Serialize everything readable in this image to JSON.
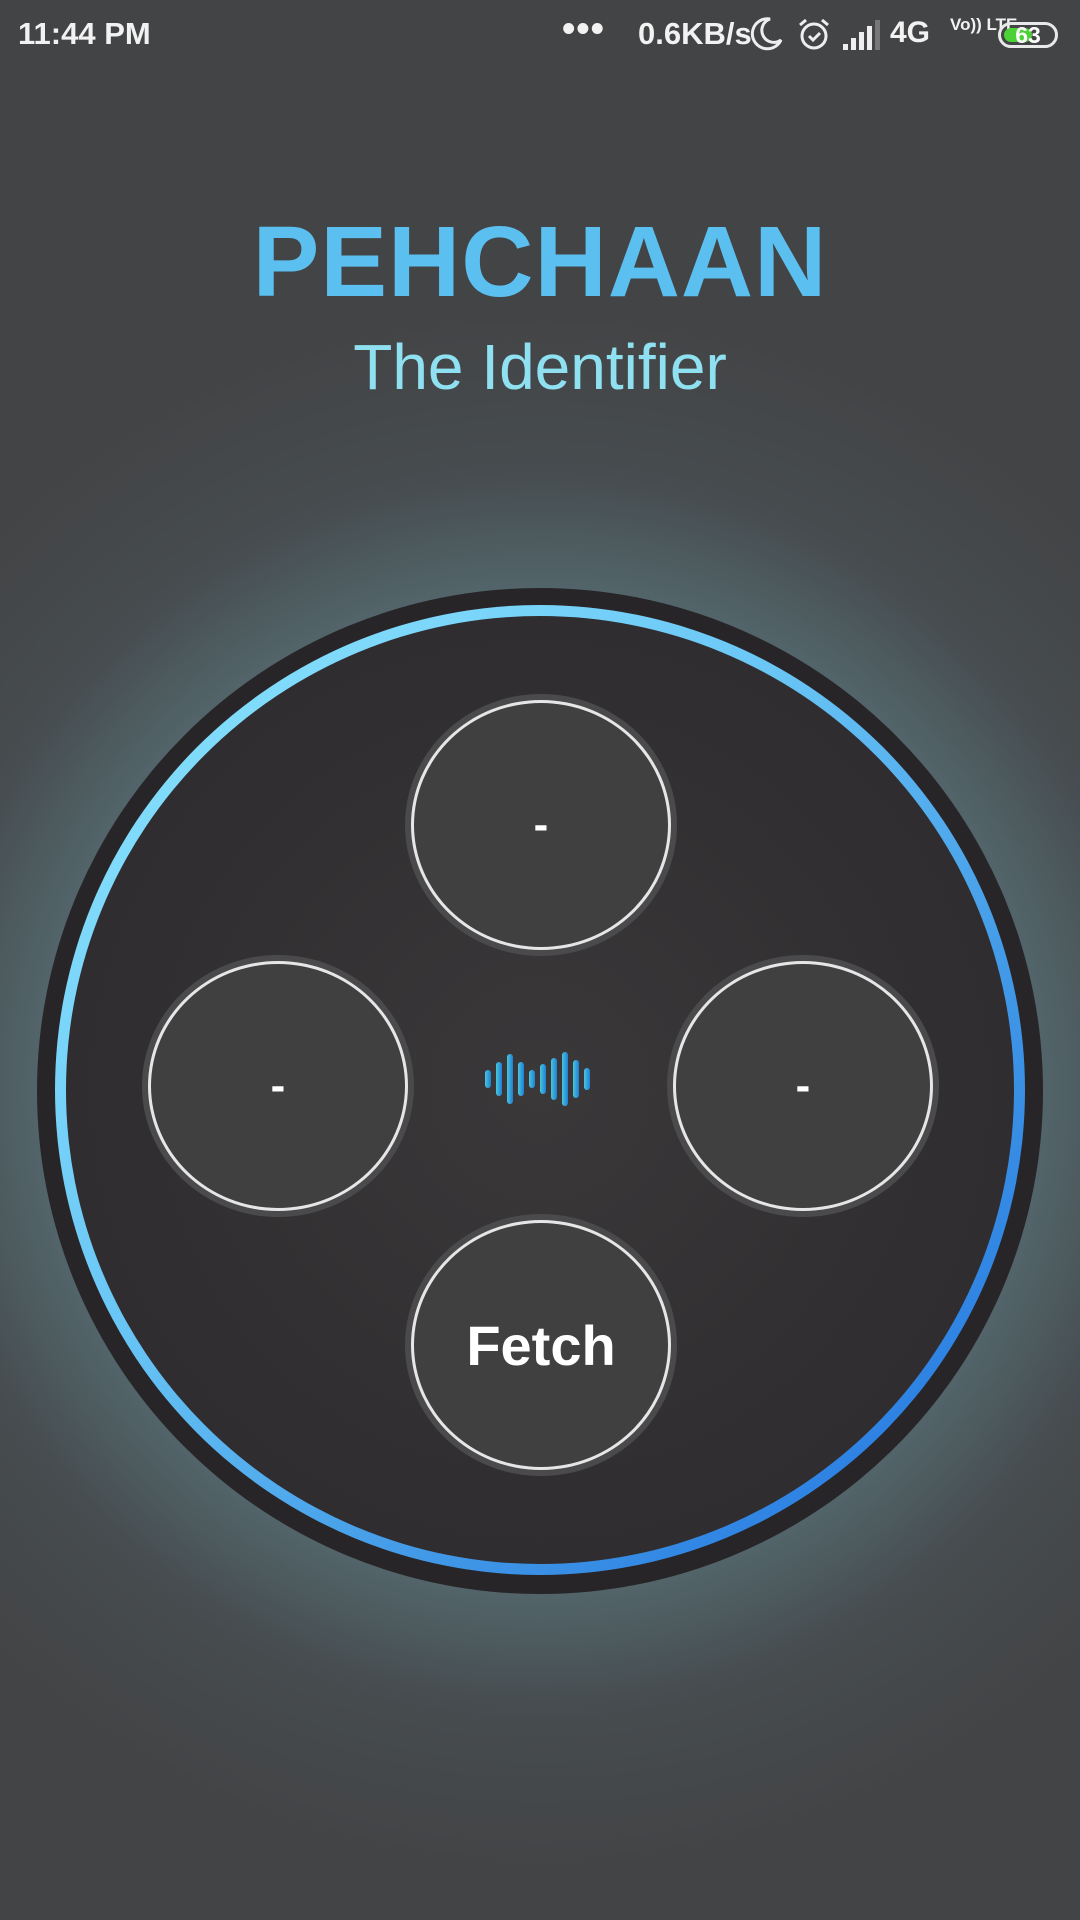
{
  "status_bar": {
    "time": "11:44 PM",
    "dots": "•••",
    "net_speed": "0.6KB/s",
    "network": "4G",
    "volte": "Vo)) LTE",
    "battery": "63",
    "battery_level": 0.63,
    "battery_color": "#4cd137"
  },
  "header": {
    "title": "PEHCHAAN",
    "subtitle": "The Identifier",
    "title_color": "#5bc0f0",
    "subtitle_color": "#8fe0f0"
  },
  "controls": {
    "top": "-",
    "left": "-",
    "right": "-",
    "bottom": "Fetch"
  },
  "icons": {
    "center": "sound-wave-icon",
    "status": [
      "moon-icon",
      "alarm-icon",
      "signal-icon"
    ]
  }
}
